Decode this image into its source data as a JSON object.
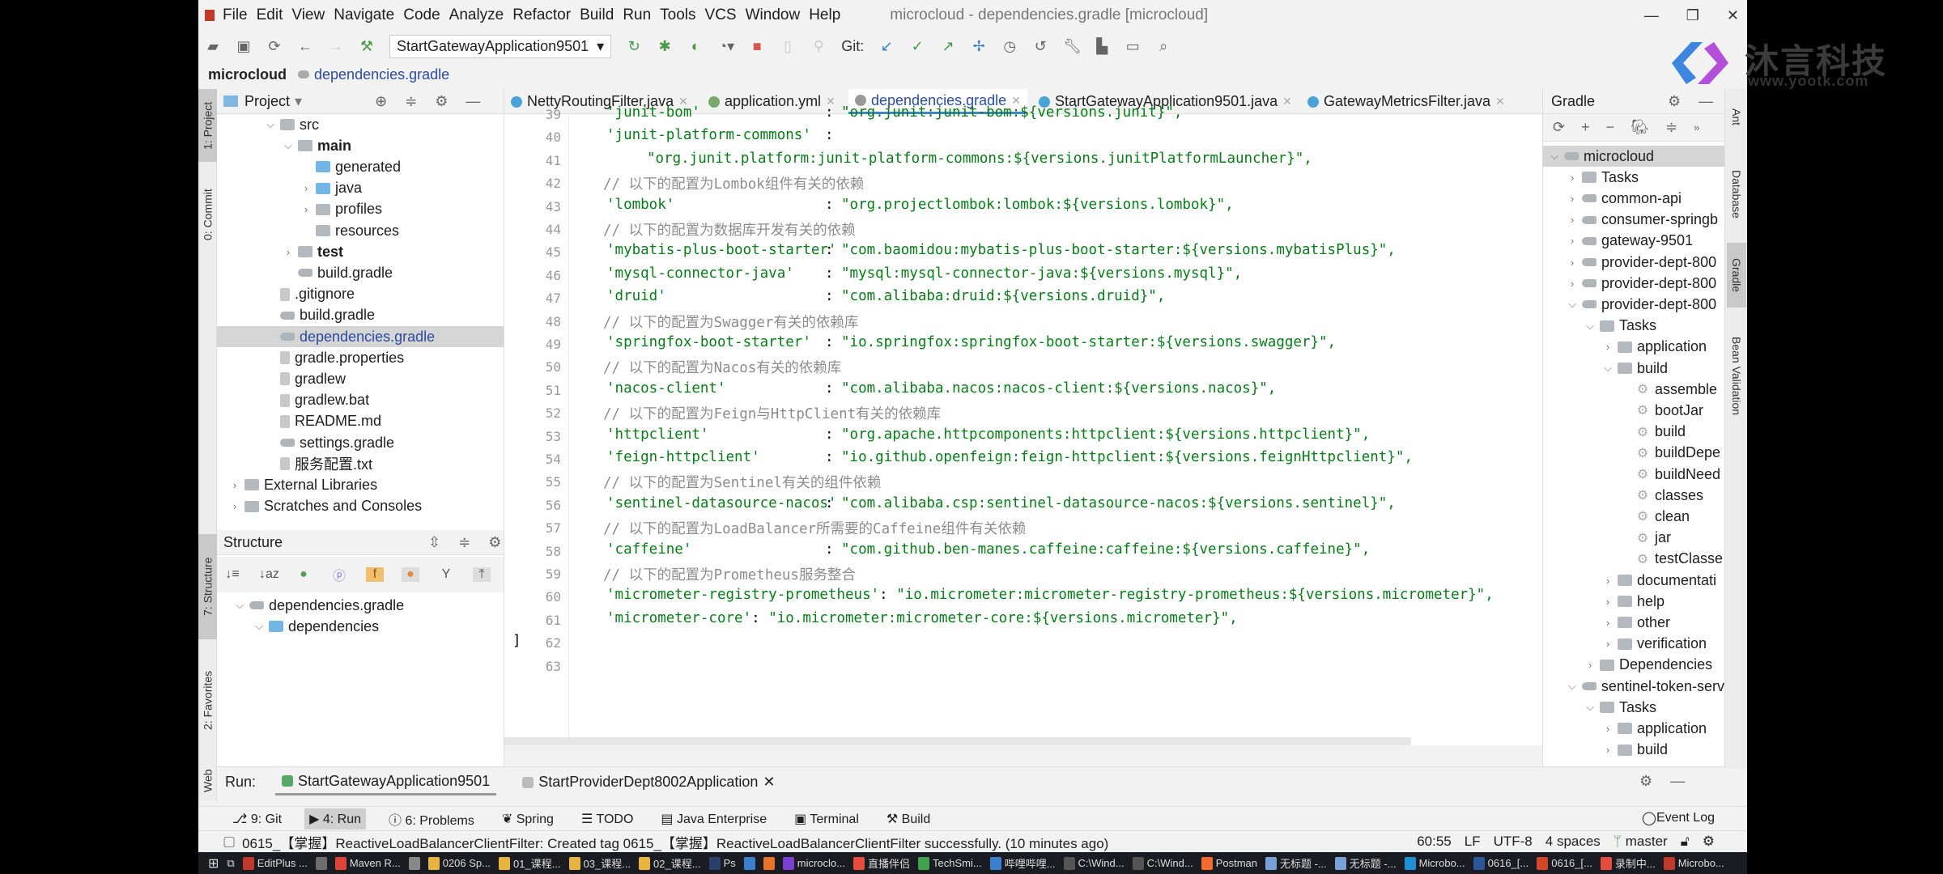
{
  "window": {
    "title": "microcloud - dependencies.gradle [microcloud]",
    "controls": [
      "—",
      "❐",
      "✕"
    ]
  },
  "menu": [
    "File",
    "Edit",
    "View",
    "Navigate",
    "Code",
    "Analyze",
    "Refactor",
    "Build",
    "Run",
    "Tools",
    "VCS",
    "Window",
    "Help"
  ],
  "toolbar": {
    "run_config": "StartGatewayApplication9501",
    "git_label": "Git:"
  },
  "breadcrumb": {
    "project": "microcloud",
    "file": "dependencies.gradle"
  },
  "watermark": {
    "name": "沐言科技",
    "url": "www.yootk.com"
  },
  "left_strip": [
    "1: Project",
    "0: Commit",
    "7: Structure",
    "2: Favorites",
    "Web"
  ],
  "right_strip": [
    "Ant",
    "Database",
    "Gradle",
    "Bean Validation"
  ],
  "project_panel": {
    "title": "Project",
    "items": [
      {
        "label": "src",
        "level": 2,
        "expanded": true,
        "icon": "folder"
      },
      {
        "label": "main",
        "level": 3,
        "expanded": true,
        "icon": "folder",
        "bold": true
      },
      {
        "label": "generated",
        "level": 4,
        "icon": "folder-blue"
      },
      {
        "label": "java",
        "level": 4,
        "expanded": false,
        "icon": "folder-blue"
      },
      {
        "label": "profiles",
        "level": 4,
        "expanded": false,
        "icon": "folder"
      },
      {
        "label": "resources",
        "level": 4,
        "icon": "folder"
      },
      {
        "label": "test",
        "level": 3,
        "expanded": false,
        "icon": "folder",
        "bold": true
      },
      {
        "label": "build.gradle",
        "level": 3,
        "icon": "gradle"
      },
      {
        "label": ".gitignore",
        "level": 2,
        "icon": "file"
      },
      {
        "label": "build.gradle",
        "level": 2,
        "icon": "gradle"
      },
      {
        "label": "dependencies.gradle",
        "level": 2,
        "icon": "gradle",
        "selected": true
      },
      {
        "label": "gradle.properties",
        "level": 2,
        "icon": "file"
      },
      {
        "label": "gradlew",
        "level": 2,
        "icon": "file"
      },
      {
        "label": "gradlew.bat",
        "level": 2,
        "icon": "file"
      },
      {
        "label": "README.md",
        "level": 2,
        "icon": "file"
      },
      {
        "label": "settings.gradle",
        "level": 2,
        "icon": "gradle"
      },
      {
        "label": "服务配置.txt",
        "level": 2,
        "icon": "file"
      },
      {
        "label": "External Libraries",
        "level": 0,
        "expanded": false,
        "icon": "library"
      },
      {
        "label": "Scratches and Consoles",
        "level": 0,
        "expanded": false,
        "icon": "scratch"
      }
    ]
  },
  "structure_panel": {
    "title": "Structure",
    "items": [
      {
        "label": "dependencies.gradle",
        "level": 0,
        "expanded": true,
        "icon": "gradle"
      },
      {
        "label": "dependencies",
        "level": 1,
        "expanded": true,
        "icon": "class"
      }
    ]
  },
  "editor": {
    "tabs": [
      {
        "label": "NettyRoutingFilter.java"
      },
      {
        "label": "application.yml"
      },
      {
        "label": "dependencies.gradle",
        "active": true
      },
      {
        "label": "StartGatewayApplication9501.java"
      },
      {
        "label": "GatewayMetricsFilter.java"
      }
    ],
    "inspection_count": "2",
    "lines": [
      {
        "n": "39",
        "type": "pair",
        "key": "'junit-bom'",
        "value": "\"org.junit:junit-bom:${versions.junit}\","
      },
      {
        "n": "40",
        "type": "key",
        "key": "'junit-platform-commons'"
      },
      {
        "n": "41",
        "type": "cont",
        "value": "\"org.junit.platform:junit-platform-commons:${versions.junitPlatformLauncher}\","
      },
      {
        "n": "42",
        "type": "comment",
        "text": "// 以下的配置为Lombok组件有关的依赖"
      },
      {
        "n": "43",
        "type": "pair",
        "key": "'lombok'",
        "value": "\"org.projectlombok:lombok:${versions.lombok}\","
      },
      {
        "n": "44",
        "type": "comment",
        "text": "// 以下的配置为数据库开发有关的依赖"
      },
      {
        "n": "45",
        "type": "pair",
        "key": "'mybatis-plus-boot-starter'",
        "value": "\"com.baomidou:mybatis-plus-boot-starter:${versions.mybatisPlus}\","
      },
      {
        "n": "46",
        "type": "pair",
        "key": "'mysql-connector-java'",
        "value": "\"mysql:mysql-connector-java:${versions.mysql}\","
      },
      {
        "n": "47",
        "type": "pair",
        "key": "'druid'",
        "value": "\"com.alibaba:druid:${versions.druid}\","
      },
      {
        "n": "48",
        "type": "comment",
        "text": "// 以下的配置为Swagger有关的依赖库"
      },
      {
        "n": "49",
        "type": "pair",
        "key": "'springfox-boot-starter'",
        "value": "\"io.springfox:springfox-boot-starter:${versions.swagger}\","
      },
      {
        "n": "50",
        "type": "comment",
        "text": "// 以下的配置为Nacos有关的依赖库"
      },
      {
        "n": "51",
        "type": "pair",
        "key": "'nacos-client'",
        "value": "\"com.alibaba.nacos:nacos-client:${versions.nacos}\","
      },
      {
        "n": "52",
        "type": "comment",
        "text": "// 以下的配置为Feign与HttpClient有关的依赖库"
      },
      {
        "n": "53",
        "type": "pair",
        "key": "'httpclient'",
        "value": "\"org.apache.httpcomponents:httpclient:${versions.httpclient}\","
      },
      {
        "n": "54",
        "type": "pair",
        "key": "'feign-httpclient'",
        "value": "\"io.github.openfeign:feign-httpclient:${versions.feignHttpclient}\","
      },
      {
        "n": "55",
        "type": "comment",
        "text": "// 以下的配置为Sentinel有关的组件依赖"
      },
      {
        "n": "56",
        "type": "pair",
        "key": "'sentinel-datasource-nacos'",
        "value": "\"com.alibaba.csp:sentinel-datasource-nacos:${versions.sentinel}\","
      },
      {
        "n": "57",
        "type": "comment",
        "text": "// 以下的配置为LoadBalancer所需要的Caffeine组件有关依赖"
      },
      {
        "n": "58",
        "type": "pair",
        "key": "'caffeine'",
        "value": "\"com.github.ben-manes.caffeine:caffeine:${versions.caffeine}\","
      },
      {
        "n": "59",
        "type": "comment",
        "text": "// 以下的配置为Prometheus服务整合"
      },
      {
        "n": "60",
        "type": "inline",
        "key": "'micrometer-registry-prometheus'",
        "value": "\"io.micrometer:micrometer-registry-prometheus:${versions.micrometer}\","
      },
      {
        "n": "61",
        "type": "inline",
        "key": "'micrometer-core'",
        "value": "\"io.micrometer:micrometer-core:${versions.micrometer}\","
      },
      {
        "n": "62",
        "type": "plain",
        "text": "]"
      },
      {
        "n": "63",
        "type": "plain",
        "text": ""
      }
    ]
  },
  "gradle_panel": {
    "title": "Gradle",
    "items": [
      {
        "label": "microcloud",
        "level": 0,
        "expanded": true,
        "icon": "gradle",
        "selected": true
      },
      {
        "label": "Tasks",
        "level": 1,
        "expanded": false,
        "icon": "folder"
      },
      {
        "label": "common-api",
        "level": 1,
        "expanded": false,
        "icon": "gradle"
      },
      {
        "label": "consumer-springb",
        "level": 1,
        "expanded": false,
        "icon": "gradle"
      },
      {
        "label": "gateway-9501",
        "level": 1,
        "expanded": false,
        "icon": "gradle"
      },
      {
        "label": "provider-dept-800",
        "level": 1,
        "expanded": false,
        "icon": "gradle"
      },
      {
        "label": "provider-dept-800",
        "level": 1,
        "expanded": false,
        "icon": "gradle"
      },
      {
        "label": "provider-dept-800",
        "level": 1,
        "expanded": true,
        "icon": "gradle"
      },
      {
        "label": "Tasks",
        "level": 2,
        "expanded": true,
        "icon": "folder"
      },
      {
        "label": "application",
        "level": 3,
        "expanded": false,
        "icon": "folder"
      },
      {
        "label": "build",
        "level": 3,
        "expanded": true,
        "icon": "folder"
      },
      {
        "label": "assemble",
        "level": 4,
        "icon": "gear"
      },
      {
        "label": "bootJar",
        "level": 4,
        "icon": "gear"
      },
      {
        "label": "build",
        "level": 4,
        "icon": "gear"
      },
      {
        "label": "buildDepe",
        "level": 4,
        "icon": "gear"
      },
      {
        "label": "buildNeed",
        "level": 4,
        "icon": "gear"
      },
      {
        "label": "classes",
        "level": 4,
        "icon": "gear"
      },
      {
        "label": "clean",
        "level": 4,
        "icon": "gear"
      },
      {
        "label": "jar",
        "level": 4,
        "icon": "gear"
      },
      {
        "label": "testClasse",
        "level": 4,
        "icon": "gear"
      },
      {
        "label": "documentati",
        "level": 3,
        "expanded": false,
        "icon": "folder"
      },
      {
        "label": "help",
        "level": 3,
        "expanded": false,
        "icon": "folder"
      },
      {
        "label": "other",
        "level": 3,
        "expanded": false,
        "icon": "folder"
      },
      {
        "label": "verification",
        "level": 3,
        "expanded": false,
        "icon": "folder"
      },
      {
        "label": "Dependencies",
        "level": 2,
        "expanded": false,
        "icon": "library"
      },
      {
        "label": "sentinel-token-serv",
        "level": 1,
        "expanded": true,
        "icon": "gradle"
      },
      {
        "label": "Tasks",
        "level": 2,
        "expanded": true,
        "icon": "folder"
      },
      {
        "label": "application",
        "level": 3,
        "expanded": false,
        "icon": "folder"
      },
      {
        "label": "build",
        "level": 3,
        "expanded": false,
        "icon": "folder"
      }
    ]
  },
  "run_bar": {
    "label": "Run:",
    "tabs": [
      {
        "label": "StartGatewayApplication9501",
        "active": true
      },
      {
        "label": "StartProviderDept8002Application"
      }
    ]
  },
  "tool_buttons": [
    {
      "label": "9: Git"
    },
    {
      "label": "4: Run",
      "active": true
    },
    {
      "label": "6: Problems"
    },
    {
      "label": "Spring"
    },
    {
      "label": "TODO"
    },
    {
      "label": "Java Enterprise"
    },
    {
      "label": "Terminal"
    },
    {
      "label": "Build"
    }
  ],
  "event_log": "Event Log",
  "status": {
    "message": "0615_【掌握】ReactiveLoadBalancerClientFilter: Created tag 0615_【掌握】ReactiveLoadBalancerClientFilter successfully. (10 minutes ago)",
    "position": "60:55",
    "line_sep": "LF",
    "encoding": "UTF-8",
    "indent": "4 spaces",
    "branch": "master"
  },
  "taskbar": [
    "EditPlus ...",
    "",
    "Maven R...",
    "",
    "0206 Sp...",
    "01_课程...",
    "03_课程...",
    "02_课程...",
    "Ps",
    "",
    "",
    "microclo...",
    "直播伴侣",
    "TechSmi...",
    "哔哩哔哩...",
    "C:\\Wind...",
    "C:\\Wind...",
    "Postman",
    "无标题 -...",
    "无标题 -...",
    "Microbo...",
    "0616_[...",
    "0616_[...",
    "录制中...",
    "Microbo..."
  ],
  "colors": {
    "string": "#067d17",
    "comment": "#8c8c8c",
    "accent": "#4083c9",
    "selection": "#d5d5d5"
  }
}
